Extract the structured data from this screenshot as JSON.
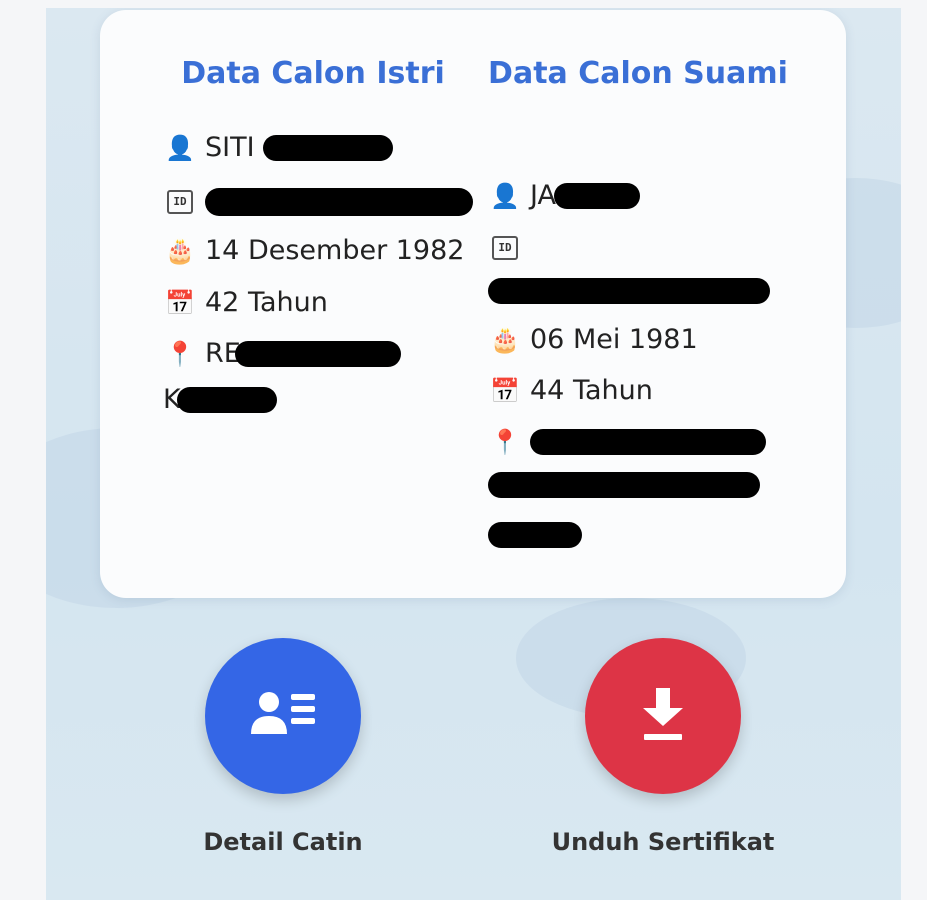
{
  "card": {
    "istri": {
      "title": "Data Calon Istri",
      "name": "SITI",
      "id_label": "ID",
      "birth_date": "14 Desember 1982",
      "age": "42 Tahun",
      "address_prefix": "RE",
      "address_line2_prefix": "K"
    },
    "suami": {
      "title": "Data Calon Suami",
      "name": "JA",
      "id_label": "ID",
      "birth_date": "06 Mei 1981",
      "age": "44 Tahun"
    }
  },
  "actions": {
    "detail_label": "Detail Catin",
    "download_label": "Unduh Sertifikat"
  },
  "colors": {
    "title": "#3a6fd6",
    "detail_button": "#3466e6",
    "download_button": "#dd3446"
  },
  "icons": {
    "person": "person-icon",
    "id": "id-card-icon",
    "birthday": "cake-icon",
    "calendar": "calendar-icon",
    "location": "pin-icon",
    "detail": "contact-card-icon",
    "download": "download-icon"
  }
}
